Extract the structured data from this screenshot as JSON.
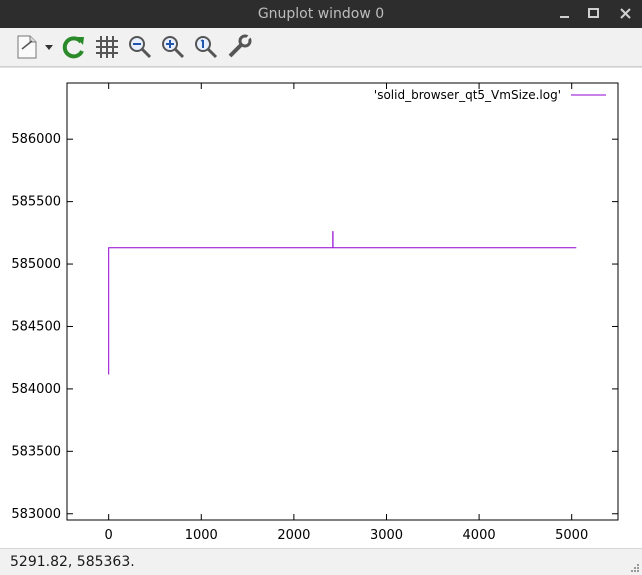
{
  "window": {
    "title": "Gnuplot window 0",
    "minimize_icon": "minimize-icon",
    "maximize_icon": "maximize-icon",
    "close_icon": "close-icon"
  },
  "toolbar": {
    "items": [
      {
        "name": "export-menu-button",
        "icon": "document-export-icon"
      },
      {
        "name": "replot-button",
        "icon": "refresh-icon"
      },
      {
        "name": "grid-toggle-button",
        "icon": "grid-icon"
      },
      {
        "name": "zoom-out-button",
        "icon": "zoom-out-icon"
      },
      {
        "name": "zoom-in-button",
        "icon": "zoom-in-icon"
      },
      {
        "name": "zoom-reset-button",
        "icon": "zoom-original-icon"
      },
      {
        "name": "settings-button",
        "icon": "wrench-icon"
      }
    ]
  },
  "status": {
    "coords": "5291.82,  585363."
  },
  "colors": {
    "series": "#9400d3",
    "titlebar": "#2d2d2d",
    "toolbar": "#f1f1f1"
  },
  "chart_data": {
    "type": "line",
    "title": "",
    "xlabel": "",
    "ylabel": "",
    "xlim": [
      -450,
      5500
    ],
    "ylim": [
      582950,
      586450
    ],
    "xticks": [
      0,
      1000,
      2000,
      3000,
      4000,
      5000
    ],
    "yticks": [
      583000,
      583500,
      584000,
      584500,
      585000,
      585500,
      586000
    ],
    "xtick_labels": [
      "0",
      "1000",
      "2000",
      "3000",
      "4000",
      "5000"
    ],
    "ytick_labels": [
      "583000",
      "583500",
      "584000",
      "584500",
      "585000",
      "585500",
      "586000"
    ],
    "grid": false,
    "legend_position": "top-right",
    "series": [
      {
        "name": "'solid_browser_qt5_VmSize.log'",
        "color": "#9400d3",
        "x": [
          0,
          0,
          10,
          2420,
          2420,
          2422,
          2422,
          5050
        ],
        "y": [
          584115,
          585130,
          585130,
          585130,
          585260,
          585260,
          585130,
          585130
        ]
      }
    ]
  }
}
